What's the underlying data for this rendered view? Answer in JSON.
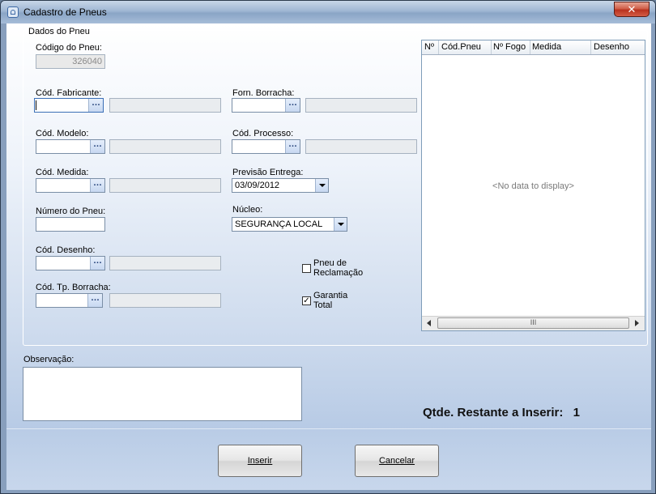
{
  "window": {
    "title": "Cadastro de Pneus",
    "close_label": "✕"
  },
  "group": {
    "title": "Dados do Pneu"
  },
  "fields": {
    "codigo_pneu": {
      "label": "Código do Pneu:",
      "value": "326040"
    },
    "cod_fabricante": {
      "label": "Cód. Fabricante:",
      "value": "",
      "desc": ""
    },
    "forn_borracha": {
      "label": "Forn. Borracha:",
      "value": "",
      "desc": ""
    },
    "cod_modelo": {
      "label": "Cód. Modelo:",
      "value": "",
      "desc": ""
    },
    "cod_processo": {
      "label": "Cód. Processo:",
      "value": "",
      "desc": ""
    },
    "cod_medida": {
      "label": "Cód. Medida:",
      "value": "",
      "desc": ""
    },
    "previsao_entrega": {
      "label": "Previsão Entrega:",
      "value": "03/09/2012"
    },
    "numero_pneu": {
      "label": "Número do Pneu:",
      "value": ""
    },
    "nucleo": {
      "label": "Núcleo:",
      "value": "SEGURANÇA LOCAL"
    },
    "cod_desenho": {
      "label": "Cód. Desenho:",
      "value": "",
      "desc": ""
    },
    "cod_tp_borracha": {
      "label": "Cód. Tp. Borracha:",
      "value": "",
      "desc": ""
    }
  },
  "checkboxes": {
    "pneu_reclamacao": {
      "line1": "Pneu de",
      "line2": "Reclamação",
      "checked": false
    },
    "garantia_total": {
      "line1": "Garantia",
      "line2": "Total",
      "checked": true,
      "mark": "✓"
    }
  },
  "grid": {
    "columns": [
      "Nº",
      "Cód.Pneu",
      "Nº Fogo",
      "Medida",
      "Desenho"
    ],
    "empty_text": "<No data to display>",
    "thumb_grip": "III"
  },
  "observacao": {
    "label": "Observação:",
    "value": ""
  },
  "qtde": {
    "label": "Qtde. Restante a Inserir:",
    "value": "1"
  },
  "buttons": {
    "inserir": "Inserir",
    "cancelar": "Cancelar"
  },
  "icons": {
    "lookup": "…"
  }
}
